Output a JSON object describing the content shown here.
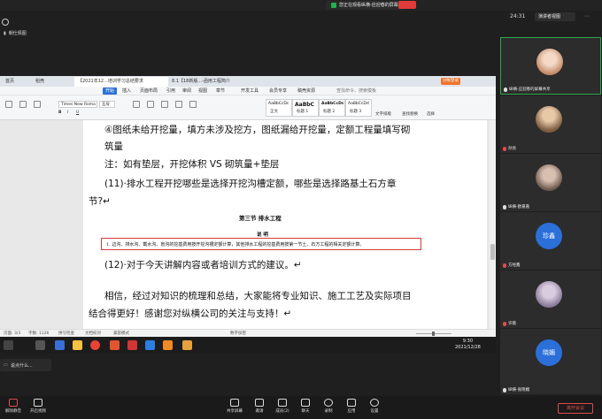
{
  "top": {
    "share_notice": "您正在观看纵横-应迎春的屏幕",
    "time": "24:31",
    "view_mode": "演讲者视图",
    "sharer_label": "朝仕佩图"
  },
  "wps": {
    "tabs": [
      "首页",
      "稻壳",
      "【2021年12...培训学习总结要求",
      "8.1【18新版...-函用工程简介"
    ],
    "login": "分帐登录",
    "menus": [
      "开始",
      "插入",
      "页面布局",
      "引用",
      "审阅",
      "视图",
      "章节",
      "开发工具",
      "会员专享",
      "稿壳资源",
      "查找命令、搜索模板"
    ],
    "ribbon": {
      "font": "Times New Roma",
      "size": "五号",
      "styles": [
        {
          "sample": "AaBbCcDc",
          "name": "正文"
        },
        {
          "sample": "AaBbC",
          "name": "标题 1"
        },
        {
          "sample": "AaBbCcDc",
          "name": "标题 2"
        },
        {
          "sample": "AaBbCcDd",
          "name": "标题 3"
        }
      ],
      "right_labels": [
        "文字排版",
        "查找替换",
        "选择"
      ]
    },
    "doc": {
      "lines": [
        "④图纸未给开挖量，填方未涉及挖方，图纸漏给开挖量，定额工程量填写砌",
        "筑量",
        "注：如有垫层，开挖体积 VS 砌筑量+垫层",
        "(11)·排水工程开挖哪些是选择开挖沟槽定额，哪些是选择路基土石方章",
        "节?↵",
        "(12)·对于今天讲解内容或者培训方式的建议。↵",
        "相信，经过对知识的梳理和总结，大家能将专业知识、施工工艺及实际项目",
        "结合得更好！感谢您对纵横公司的关注与支持！↵"
      ],
      "section_title": "第三节      排水工程",
      "note_title": "说    明",
      "note_text": "1. 边沟、排水沟、截水沟、盲沟的挖基费用按开挖沟槽定额计算，其他排水工程的挖基费用按第一节土、石方工程的相关定额计算。"
    },
    "status": {
      "page": "页面: 3/3",
      "words": "字数: 1126",
      "spell": "拼写检查",
      "proof": "文档校对",
      "compat": "兼容模式",
      "mode": "数字加密"
    },
    "taskbar_time": "9:30",
    "taskbar_date": "2021/12/28"
  },
  "subtitle": "说点什么...",
  "participants": [
    {
      "name": "纵横-应迎春的屏幕共享",
      "type": "photo",
      "selected": true,
      "mic": "on"
    },
    {
      "name": "孙亮",
      "type": "photo",
      "selected": false,
      "mic": "off"
    },
    {
      "name": "纵横-欧嘉嘉",
      "type": "photo",
      "selected": false,
      "mic": "on"
    },
    {
      "name": "方经鑫",
      "type": "text",
      "initials": "珍鑫",
      "selected": false,
      "mic": "off"
    },
    {
      "name": "许薇",
      "type": "photo",
      "selected": false,
      "mic": "off"
    },
    {
      "name": "纵横-张晓媚",
      "type": "text",
      "initials": "晓媚",
      "selected": false,
      "mic": "on"
    }
  ],
  "toolbar": {
    "left": [
      "解除静音",
      "开启视频"
    ],
    "center": [
      "共享屏幕",
      "邀请",
      "成员(2)",
      "聊天",
      "录制",
      "应用",
      "设置"
    ],
    "leave": "离开会议"
  }
}
